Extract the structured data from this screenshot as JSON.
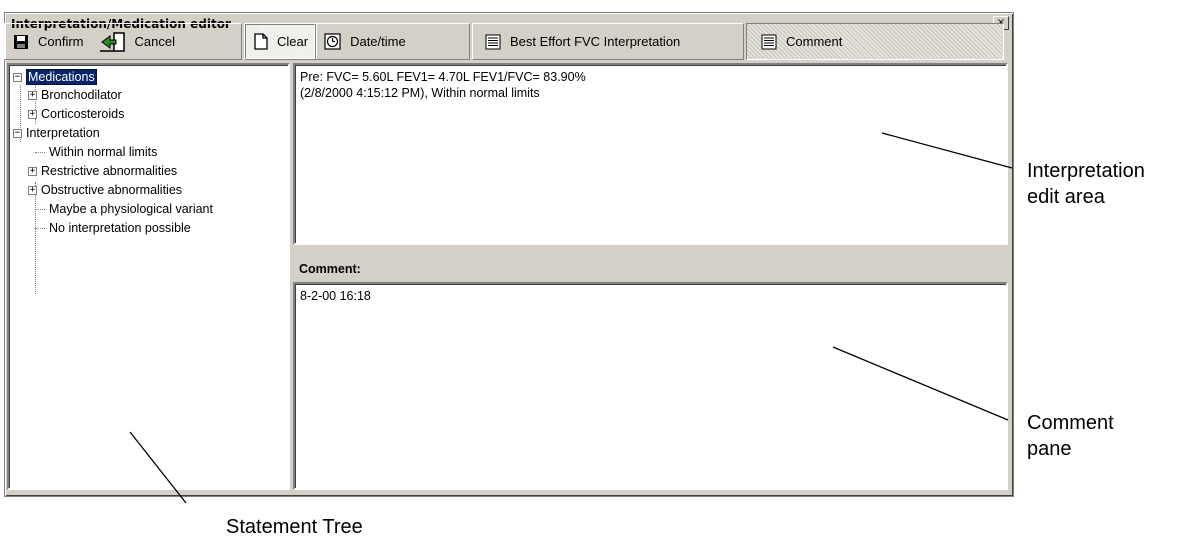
{
  "window": {
    "title": "Interpretation/Medication editor",
    "close_symbol": "×"
  },
  "toolbar": {
    "confirm_label": "Confirm",
    "cancel_label": "Cancel",
    "clear_label": "Clear",
    "datetime_label": "Date/time",
    "best_effort_label": "Best Effort FVC Interpretation",
    "comment_label": "Comment"
  },
  "tree": {
    "medications": "Medications",
    "bronchodilator": "Bronchodilator",
    "corticosteroids": "Corticosteroids",
    "interpretation": "Interpretation",
    "within_normal": "Within normal limits",
    "restrictive": "Restrictive abnormalities",
    "obstructive": "Obstructive abnormalities",
    "maybe_variant": "Maybe a physiological variant",
    "no_interpretation": "No interpretation possible",
    "collapse_symbol": "−",
    "expand_symbol": "+"
  },
  "interpretation": {
    "line1": "Pre: FVC= 5.60L FEV1= 4.70L FEV1/FVC= 83.90%",
    "line2": "(2/8/2000 4:15:12 PM), Within normal limits"
  },
  "comment": {
    "label": "Comment:",
    "text": "8-2-00 16:18"
  },
  "annotations": {
    "interp_line1": "Interpretation",
    "interp_line2": "edit area",
    "comment_line1": "Comment",
    "comment_line2": "pane",
    "tree_label": "Statement Tree"
  },
  "icons": [
    "save-icon",
    "cancel-icon",
    "clear-icon",
    "clock-icon",
    "interpretation-icon",
    "comment-icon"
  ],
  "colors": {
    "selection": "#0a246a",
    "window": "#d4d0c8"
  }
}
